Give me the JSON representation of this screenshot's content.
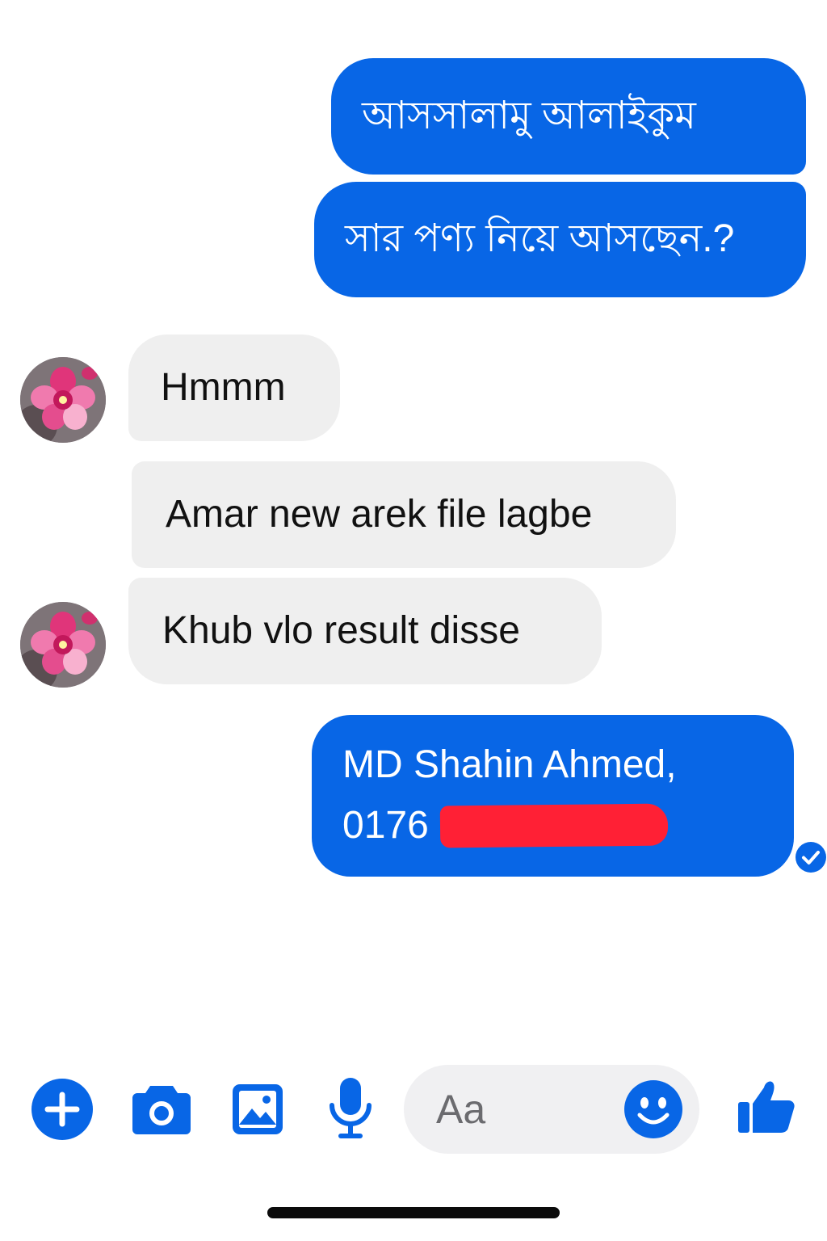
{
  "messages": [
    {
      "direction": "outgoing",
      "text": "আসসালামু আলাইকুম"
    },
    {
      "direction": "outgoing",
      "text": "সার পণ্য নিয়ে আসছেন.?"
    },
    {
      "direction": "incoming",
      "text": "Hmmm"
    },
    {
      "direction": "incoming",
      "text": "Amar new arek file lagbe"
    },
    {
      "direction": "incoming",
      "text": "Khub vlo result disse"
    },
    {
      "direction": "outgoing",
      "line1": "MD Shahin Ahmed,",
      "line2_visible": "0176",
      "status": "seen"
    }
  ],
  "composer": {
    "placeholder": "Aa"
  },
  "toolbar": {
    "icons": [
      "plus-icon",
      "camera-icon",
      "image-icon",
      "microphone-icon",
      "emoji-icon",
      "thumbs-up-icon"
    ]
  },
  "colors": {
    "outgoing_bubble": "#0866e6",
    "incoming_bubble": "#efefef",
    "accent": "#0866e6",
    "redaction": "#ff2035"
  }
}
